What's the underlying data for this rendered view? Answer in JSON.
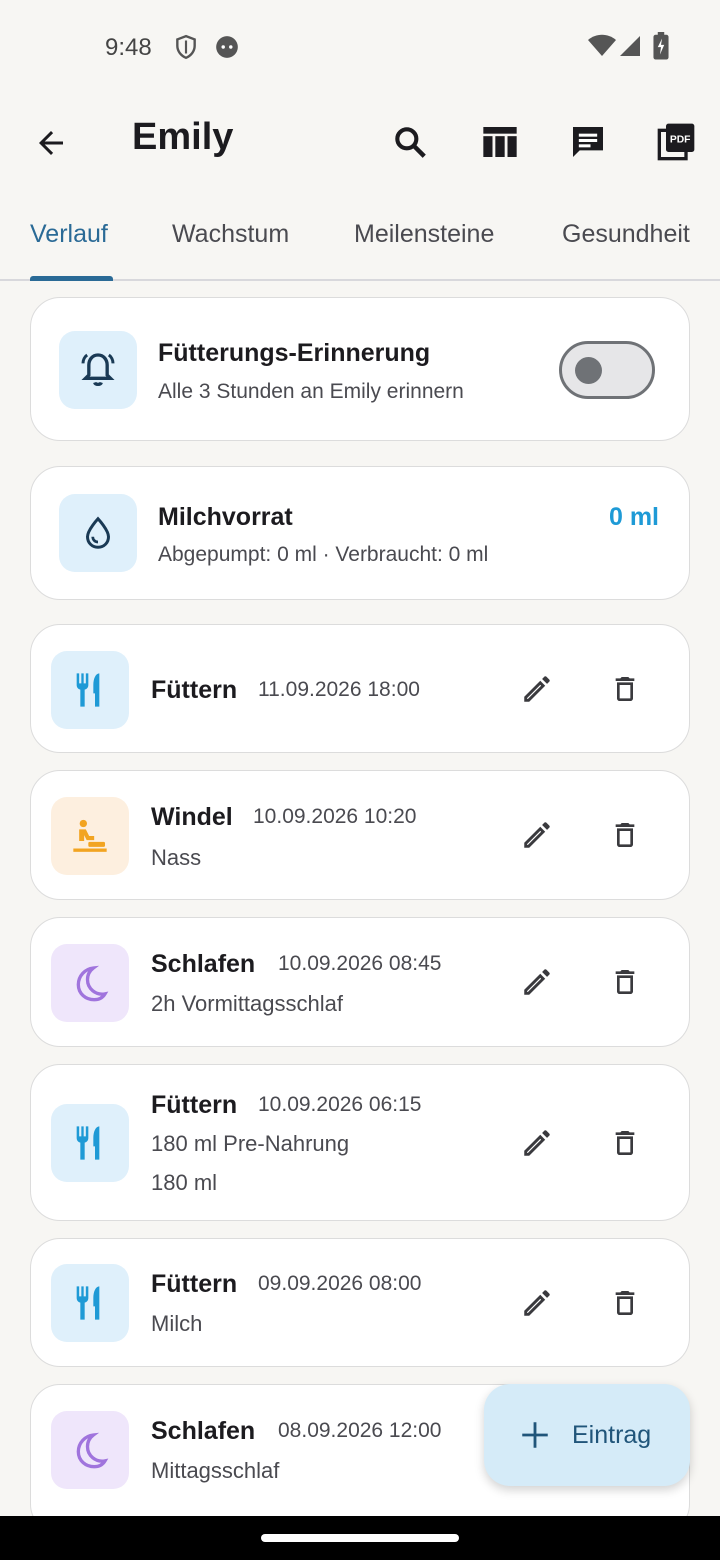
{
  "status_bar": {
    "time": "9:48"
  },
  "app_bar": {
    "title": "Emily"
  },
  "tabs": [
    {
      "label": "Verlauf",
      "active": true
    },
    {
      "label": "Wachstum",
      "active": false
    },
    {
      "label": "Meilensteine",
      "active": false
    },
    {
      "label": "Gesundheit",
      "active": false
    }
  ],
  "reminder": {
    "title": "Fütterungs-Erinnerung",
    "subtitle": "Alle 3 Stunden an Emily erinnern",
    "enabled": false
  },
  "milk": {
    "title": "Milchvorrat",
    "subtitle": "Abgepumpt: 0 ml · Verbraucht: 0 ml",
    "amount": "0 ml"
  },
  "entries": [
    {
      "type": "Füttern",
      "date": "11.09.2026 18:00",
      "icon": "fork-knife-icon"
    },
    {
      "type": "Windel",
      "date": "10.09.2026 10:20",
      "note": "Nass",
      "icon": "baby-changing-icon"
    },
    {
      "type": "Schlafen",
      "date": "10.09.2026 08:45",
      "note": "2h Vormittagsschlaf",
      "icon": "moon-icon"
    },
    {
      "type": "Füttern",
      "date": "10.09.2026 06:15",
      "note": "180 ml Pre-Nahrung",
      "note2": "180 ml",
      "icon": "fork-knife-icon"
    },
    {
      "type": "Füttern",
      "date": "09.09.2026 08:00",
      "note": "Milch",
      "icon": "fork-knife-icon"
    },
    {
      "type": "Schlafen",
      "date": "08.09.2026 12:00",
      "note": "Mittagsschlaf",
      "icon": "moon-icon"
    }
  ],
  "fab": {
    "label": "Eintrag"
  },
  "colors": {
    "accent": "#2a6a96",
    "milk_amount": "#1e9ad6",
    "feeding_icon": "#1e9ad6",
    "diaper_icon": "#f2a421",
    "sleep_icon": "#a074dd"
  }
}
